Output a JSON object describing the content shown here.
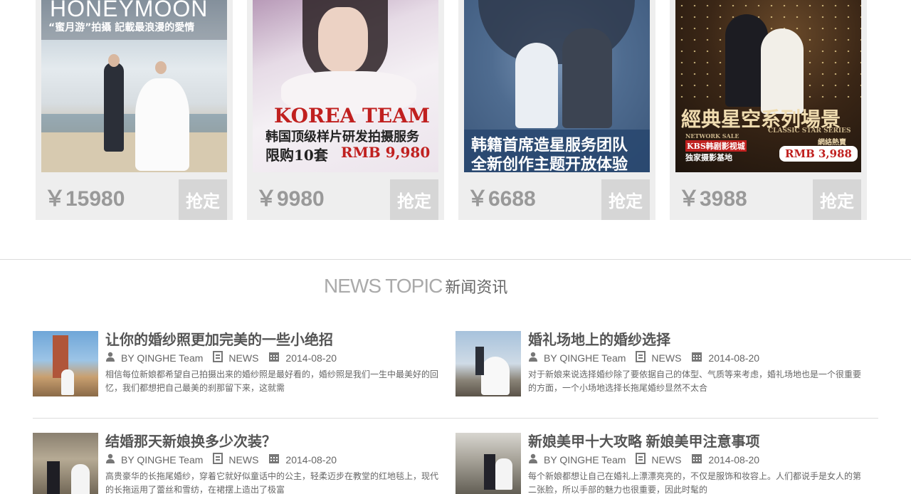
{
  "products": [
    {
      "price": "￥15980",
      "buy_label": "抢定",
      "photo_title": "HONEYMOON",
      "photo_sub": "“蜜月游”拍攝 記載最浪漫的愛情"
    },
    {
      "price": "￥9980",
      "buy_label": "抢定",
      "photo_title": "KOREA TEAM",
      "photo_line2": "韩国顶级样片研发拍摄服务",
      "photo_line3a": "限购10套",
      "photo_line3b": "RMB 9,980"
    },
    {
      "price": "￥6688",
      "buy_label": "抢定",
      "photo_line1": "韩籍首席造星服务团队",
      "photo_line2": "全新创作主题开放体验"
    },
    {
      "price": "￥3988",
      "buy_label": "抢定",
      "photo_title": "經典星空系列場景",
      "photo_sub_en": "CLASSIC STAR SERIES",
      "photo_network": "NETWORK SALE",
      "photo_hot": "網絡熱賣",
      "photo_badge1": "KBS韩剧影视城",
      "photo_badge2": "独家摄影基地",
      "photo_price": "RMB 3,988"
    }
  ],
  "section": {
    "title_en": "NEWS TOPIC",
    "title_cn": "新闻资讯"
  },
  "news": [
    {
      "title": "让你的婚纱照更加完美的一些小绝招",
      "author": "BY QINGHE Team",
      "category": "NEWS",
      "date": "2014-08-20",
      "desc": "相信每位新娘都希望自己拍摄出来的婚纱照是最好看的，婚纱照是我们一生中最美好的回忆，我们都想把自己最美的刹那留下来，这就需"
    },
    {
      "title": "婚礼场地上的婚纱选择",
      "author": "BY QINGHE Team",
      "category": "NEWS",
      "date": "2014-08-20",
      "desc": "对于新娘来说选择婚纱除了要依据自己的体型、气质等来考虑，婚礼场地也是一个很重要的方面，一个小场地选择长拖尾婚纱显然不太合"
    },
    {
      "title": "结婚那天新娘换多少次装？",
      "author": "BY QINGHE Team",
      "category": "NEWS",
      "date": "2014-08-20",
      "desc": "高贵豪华的长拖尾婚纱，穿着它就好似童话中的公主，轻柔迈步在教堂的红地毯上，现代的长拖运用了蕾丝和雪纺，在裙摆上造出了极富"
    },
    {
      "title": "新娘美甲十大攻略 新娘美甲注意事项",
      "author": "BY QINGHE Team",
      "category": "NEWS",
      "date": "2014-08-20",
      "desc": "每个新娘都想让自己在婚礼上漂漂亮亮的，不仅是服饰和妆容上。人们都说手是女人的第二张脸，所以手部的魅力也很重要，因此时髦的"
    }
  ]
}
